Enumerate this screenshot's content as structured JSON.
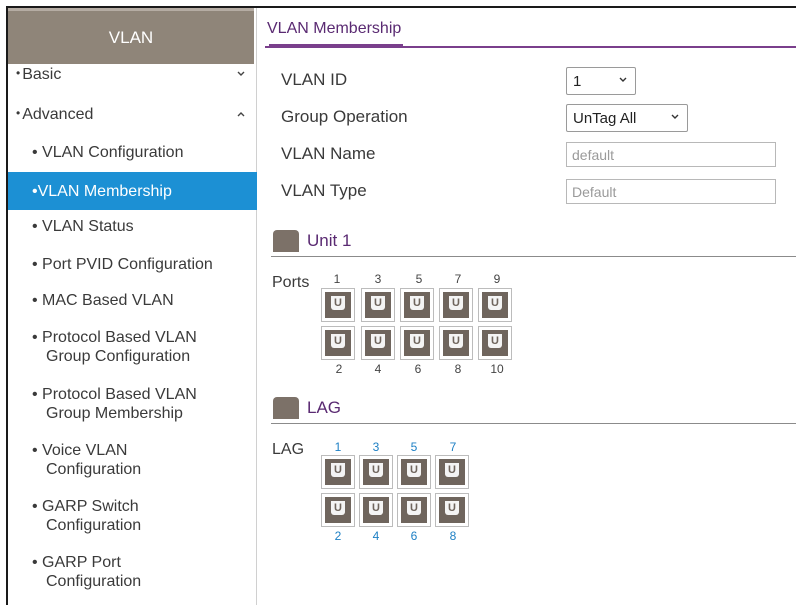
{
  "sidebar": {
    "title": "VLAN",
    "top_items": [
      {
        "label": "Basic"
      },
      {
        "label": "Advanced"
      }
    ],
    "sub_items": [
      {
        "label": "VLAN Configuration"
      },
      {
        "label": "VLAN Membership",
        "active": true
      },
      {
        "label": "VLAN Status"
      },
      {
        "label": "Port PVID Configuration"
      },
      {
        "label": "MAC Based VLAN"
      },
      {
        "label1": "Protocol Based VLAN",
        "label2": "Group Configuration"
      },
      {
        "label1": "Protocol Based VLAN",
        "label2": "Group Membership"
      },
      {
        "label1": "Voice VLAN",
        "label2": "Configuration"
      },
      {
        "label1": "GARP Switch",
        "label2": "Configuration"
      },
      {
        "label1": "GARP Port",
        "label2": "Configuration"
      }
    ]
  },
  "tab": {
    "label": "VLAN Membership"
  },
  "form": {
    "vlan_id_label": "VLAN ID",
    "vlan_id_value": "1",
    "group_op_label": "Group Operation",
    "group_op_value": "UnTag All",
    "vlan_name_label": "VLAN Name",
    "vlan_name_value": "default",
    "vlan_type_label": "VLAN Type",
    "vlan_type_value": "Default"
  },
  "unit": {
    "title": "Unit 1",
    "row_label": "Ports",
    "top_numbers": [
      "1",
      "3",
      "5",
      "7",
      "9"
    ],
    "bottom_numbers": [
      "2",
      "4",
      "6",
      "8",
      "10"
    ],
    "port_mark": "U"
  },
  "lag": {
    "title": "LAG",
    "row_label": "LAG",
    "top_numbers": [
      "1",
      "3",
      "5",
      "7"
    ],
    "bottom_numbers": [
      "2",
      "4",
      "6",
      "8"
    ],
    "port_mark": "U"
  },
  "colors": {
    "sidebar_header": "#8f8579",
    "active_item": "#1c90d4",
    "accent_purple": "#7a3f8c",
    "port_fill": "#6f655d",
    "lag_numbers": "#1c7fc4"
  }
}
